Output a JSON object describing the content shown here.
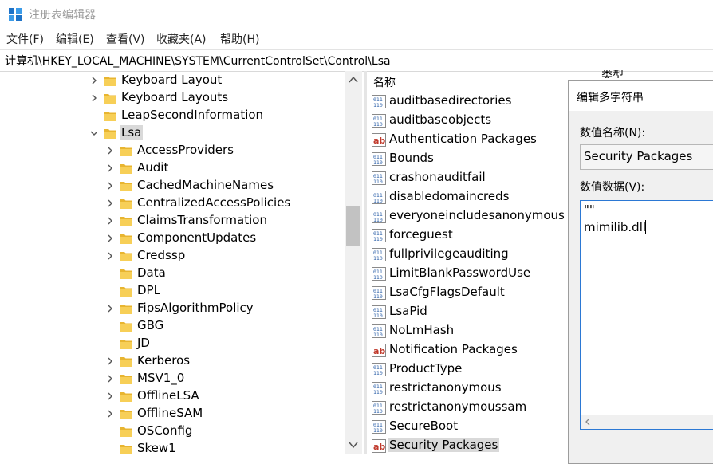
{
  "app": {
    "title": "注册表编辑器"
  },
  "menu": [
    "文件(F)",
    "编辑(E)",
    "查看(V)",
    "收藏夹(A)",
    "帮助(H)"
  ],
  "address": "计算机\\HKEY_LOCAL_MACHINE\\SYSTEM\\CurrentControlSet\\Control\\Lsa",
  "tree": {
    "top_items": [
      "Keyboard Layout",
      "Keyboard Layouts",
      "LeapSecondInformation",
      "Lsa"
    ],
    "lsa_children": [
      "AccessProviders",
      "Audit",
      "CachedMachineNames",
      "CentralizedAccessPolicies",
      "ClaimsTransformation",
      "ComponentUpdates",
      "Credssp",
      "Data",
      "DPL",
      "FipsAlgorithmPolicy",
      "GBG",
      "JD",
      "Kerberos",
      "MSV1_0",
      "OfflineLSA",
      "OfflineSAM",
      "OSConfig",
      "Skew1"
    ]
  },
  "values_pane": {
    "name_header": "名称",
    "type_header": "类型",
    "values": [
      {
        "name": "auditbasedirectories",
        "icon": "binary-value-icon"
      },
      {
        "name": "auditbaseobjects",
        "icon": "binary-value-icon"
      },
      {
        "name": "Authentication Packages",
        "icon": "string-value-icon"
      },
      {
        "name": "Bounds",
        "icon": "binary-value-icon"
      },
      {
        "name": "crashonauditfail",
        "icon": "binary-value-icon"
      },
      {
        "name": "disabledomaincreds",
        "icon": "binary-value-icon"
      },
      {
        "name": "everyoneincludesanonymous",
        "icon": "binary-value-icon"
      },
      {
        "name": "forceguest",
        "icon": "binary-value-icon"
      },
      {
        "name": "fullprivilegeauditing",
        "icon": "binary-value-icon"
      },
      {
        "name": "LimitBlankPasswordUse",
        "icon": "binary-value-icon"
      },
      {
        "name": "LsaCfgFlagsDefault",
        "icon": "binary-value-icon"
      },
      {
        "name": "LsaPid",
        "icon": "binary-value-icon"
      },
      {
        "name": "NoLmHash",
        "icon": "binary-value-icon"
      },
      {
        "name": "Notification Packages",
        "icon": "string-value-icon"
      },
      {
        "name": "ProductType",
        "icon": "binary-value-icon"
      },
      {
        "name": "restrictanonymous",
        "icon": "binary-value-icon"
      },
      {
        "name": "restrictanonymoussam",
        "icon": "binary-value-icon"
      },
      {
        "name": "SecureBoot",
        "icon": "binary-value-icon"
      },
      {
        "name": "Security Packages",
        "icon": "string-value-icon"
      }
    ]
  },
  "dialog": {
    "title": "编辑多字符串",
    "name_label": "数值名称(N):",
    "name_value": "Security Packages",
    "data_label": "数值数据(V):",
    "data_lines": [
      "\"\"",
      "mimilib.dll"
    ]
  },
  "colors": {
    "folder": "#f0c33c",
    "selection": "#d9d9d9",
    "focus_border": "#2b78d4",
    "binary_icon": "#2a5fa8",
    "string_icon": "#c0392b"
  }
}
